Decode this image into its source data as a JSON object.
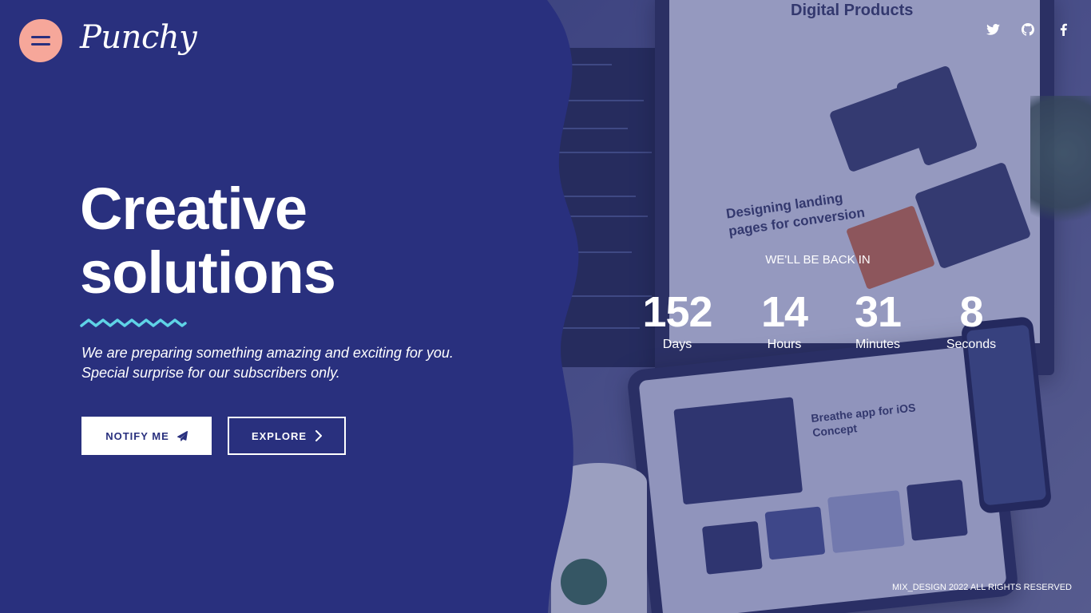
{
  "brand": {
    "logo_text": "Punchy"
  },
  "header": {
    "menu_icon": "hamburger-menu-icon",
    "social": [
      {
        "name": "twitter-icon"
      },
      {
        "name": "github-icon"
      },
      {
        "name": "facebook-icon"
      }
    ]
  },
  "hero": {
    "title_line1": "Creative",
    "title_line2": "solutions",
    "tagline": "We are preparing something amazing and exciting for you. Special surprise for our subscribers only.",
    "notify_label": "NOTIFY ME",
    "explore_label": "EXPLORE"
  },
  "countdown": {
    "heading": "WE'LL BE BACK IN",
    "units": [
      {
        "value": "152",
        "label": "Days"
      },
      {
        "value": "14",
        "label": "Hours"
      },
      {
        "value": "31",
        "label": "Minutes"
      },
      {
        "value": "8",
        "label": "Seconds"
      }
    ]
  },
  "background_photo": {
    "screen_title": "Digital Products",
    "screen_heading": "Designing landing pages for conversion",
    "tablet_heading": "Breathe app for iOS Concept"
  },
  "footer": {
    "copyright": "MIX_DESIGN 2022 ALL RIGHTS RESERVED"
  },
  "colors": {
    "primary": "#29307e",
    "accent_pink": "#f6a79a",
    "accent_cyan": "#5fd3e6",
    "white": "#ffffff"
  }
}
